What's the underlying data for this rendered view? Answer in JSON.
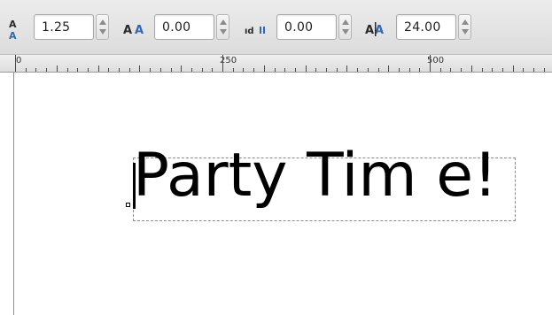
{
  "toolbar": {
    "line_spacing": {
      "icon": "line-spacing-icon",
      "value": "1.25"
    },
    "letter_spacing": {
      "icon": "letter-spacing-icon",
      "glyph": "AA",
      "value": "0.00"
    },
    "word_spacing": {
      "icon": "word-spacing-icon",
      "glyph": "ıd ıı",
      "value": "0.00"
    },
    "kerning": {
      "icon": "kerning-icon",
      "glyph": "AA",
      "value": "24.00"
    }
  },
  "ruler": {
    "labels": [
      "0",
      "250",
      "500"
    ]
  },
  "canvas": {
    "text": "Party Tim e!"
  },
  "colors": {
    "icon_blue": "#2f68b4",
    "toolbar_bg": "#e4e4e4",
    "selection_dash": "#8a8a8a"
  }
}
